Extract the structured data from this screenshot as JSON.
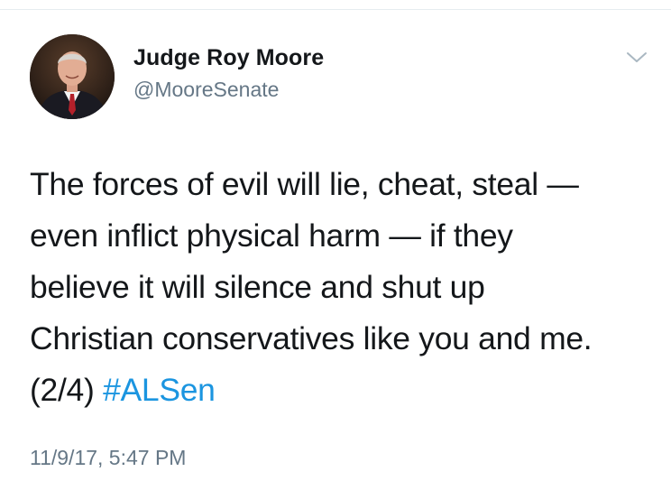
{
  "author": {
    "display_name": "Judge Roy Moore",
    "handle": "@MooreSenate"
  },
  "tweet": {
    "lines": [
      "The forces of evil will lie, cheat, steal —",
      "even inflict physical harm — if they",
      "believe it will silence and shut up",
      "Christian conservatives like you and me."
    ],
    "last_line_prefix": "(2/4) ",
    "hashtag": "#ALSen",
    "timestamp": "11/9/17, 5:47 PM"
  },
  "icons": {
    "menu": "chevron-down-icon",
    "avatar": "profile-photo"
  },
  "colors": {
    "text": "#14171a",
    "secondary": "#657786",
    "link": "#1b95e0",
    "divider": "#e6ecf0"
  }
}
